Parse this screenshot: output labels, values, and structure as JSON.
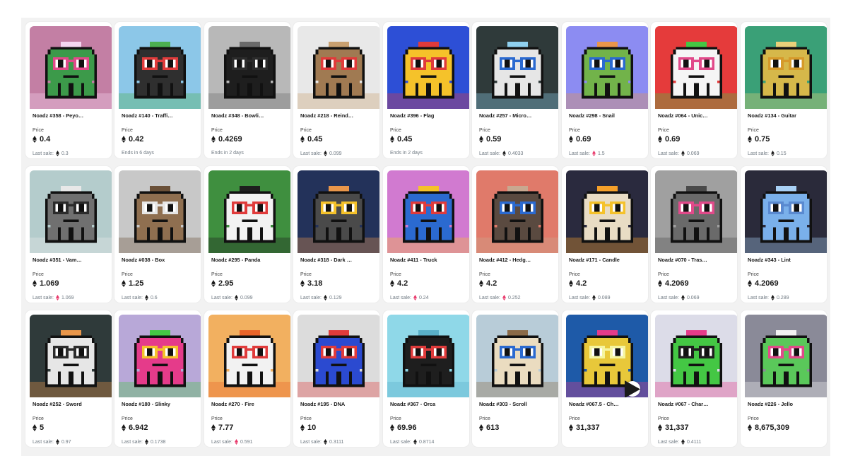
{
  "price_label": "Price",
  "cards": [
    {
      "name": "Noadz #358 - Peyo…",
      "price": "0.4",
      "footer_text": "Last sale:",
      "footer_value": "0.3",
      "footer_eth": "gray",
      "bg": "#c37fa4",
      "body": "#3c9a4a",
      "glasses": "#e14a8a",
      "accent": "#f4d6f0"
    },
    {
      "name": "Noadz #140 - Traffi…",
      "price": "0.42",
      "footer_text": "Ends in 6 days",
      "footer_value": "",
      "footer_eth": "none",
      "bg": "#8cc7e8",
      "body": "#2f2f2f",
      "glasses": "#e03b3b",
      "accent": "#4caf50"
    },
    {
      "name": "Noadz #348 - Bowli…",
      "price": "0.4269",
      "footer_text": "Ends in 2 days",
      "footer_value": "",
      "footer_eth": "none",
      "bg": "#b8b8b8",
      "body": "#1e1e1e",
      "glasses": "#2b2b2b",
      "accent": "#6a6a6a"
    },
    {
      "name": "Noadz #218 - Reind…",
      "price": "0.45",
      "footer_text": "Last sale:",
      "footer_value": "0.099",
      "footer_eth": "gray",
      "bg": "#e8e8e8",
      "body": "#a07a52",
      "glasses": "#e03b3b",
      "accent": "#c8a070"
    },
    {
      "name": "Noadz #396 - Flag",
      "price": "0.45",
      "footer_text": "Ends in 2 days",
      "footer_value": "",
      "footer_eth": "none",
      "bg": "#2d4fd6",
      "body": "#f5c22a",
      "glasses": "#e03b3b",
      "accent": "#e03b3b"
    },
    {
      "name": "Noadz #257 - Micro…",
      "price": "0.59",
      "footer_text": "Last sale:",
      "footer_value": "0.4033",
      "footer_eth": "gray",
      "bg": "#2f3a3a",
      "body": "#e6e6e6",
      "glasses": "#2b6ad0",
      "accent": "#8fd0ef"
    },
    {
      "name": "Noadz #298 - Snail",
      "price": "0.69",
      "footer_text": "Last sale:",
      "footer_value": "1.5",
      "footer_eth": "pink",
      "bg": "#8c8cf2",
      "body": "#72b34a",
      "glasses": "#2b6ad0",
      "accent": "#e9964a"
    },
    {
      "name": "Noadz #064 - Unic…",
      "price": "0.69",
      "footer_text": "Last sale:",
      "footer_value": "0.069",
      "footer_eth": "gray",
      "bg": "#e53b3b",
      "body": "#f5f5f5",
      "glasses": "#e14a8a",
      "accent": "#44c744"
    },
    {
      "name": "Noadz #134 - Guitar",
      "price": "0.75",
      "footer_text": "Last sale:",
      "footer_value": "0.15",
      "footer_eth": "gray",
      "bg": "#3aa077",
      "body": "#d6b84a",
      "glasses": "#d69a2a",
      "accent": "#e9d07a"
    },
    {
      "name": "Noadz #351 - Vam…",
      "price": "1.069",
      "footer_text": "Last sale:",
      "footer_value": "1.069",
      "footer_eth": "pink",
      "bg": "#b4cccc",
      "body": "#707070",
      "glasses": "#2b2b2b",
      "accent": "#e8e8e8"
    },
    {
      "name": "Noadz #038 - Box",
      "price": "1.25",
      "footer_text": "Last sale:",
      "footer_value": "0.6",
      "footer_eth": "gray",
      "bg": "#c8c8c8",
      "body": "#8f6f50",
      "glasses": "#e6e6e6",
      "accent": "#6a5038"
    },
    {
      "name": "Noadz #295 - Panda",
      "price": "2.95",
      "footer_text": "Last sale:",
      "footer_value": "0.099",
      "footer_eth": "gray",
      "bg": "#3f8f3f",
      "body": "#f2f2f2",
      "glasses": "#e03b3b",
      "accent": "#1e1e1e"
    },
    {
      "name": "Noadz #318 - Dark …",
      "price": "3.18",
      "footer_text": "Last sale:",
      "footer_value": "0.129",
      "footer_eth": "gray",
      "bg": "#23325a",
      "body": "#4a4a4a",
      "glasses": "#f5c22a",
      "accent": "#e9964a"
    },
    {
      "name": "Noadz #411 - Truck",
      "price": "4.2",
      "footer_text": "Last sale:",
      "footer_value": "0.24",
      "footer_eth": "pink",
      "bg": "#d17ad0",
      "body": "#2b6ad0",
      "glasses": "#e03b3b",
      "accent": "#f5c22a"
    },
    {
      "name": "Noadz #412 - Hedg…",
      "price": "4.2",
      "footer_text": "Last sale:",
      "footer_value": "0.252",
      "footer_eth": "pink",
      "bg": "#e07a6a",
      "body": "#5a4a40",
      "glasses": "#2b6ad0",
      "accent": "#c8a890"
    },
    {
      "name": "Noadz #171 - Candle",
      "price": "4.2",
      "footer_text": "Last sale:",
      "footer_value": "0.089",
      "footer_eth": "gray",
      "bg": "#2a2a3e",
      "body": "#e8dcc4",
      "glasses": "#f5c22a",
      "accent": "#f5a02a"
    },
    {
      "name": "Noadz #070 - Tras…",
      "price": "4.2069",
      "footer_text": "Last sale:",
      "footer_value": "0.069",
      "footer_eth": "gray",
      "bg": "#a0a0a0",
      "body": "#6a6a6a",
      "glasses": "#e14a8a",
      "accent": "#4a4a4a"
    },
    {
      "name": "Noadz #343 - Lint",
      "price": "4.2069",
      "footer_text": "Last sale:",
      "footer_value": "0.289",
      "footer_eth": "gray",
      "bg": "#2a2a3a",
      "body": "#7ab0ea",
      "glasses": "#5a8ad0",
      "accent": "#a8d0f5"
    },
    {
      "name": "Noadz #252 - Sword",
      "price": "5",
      "footer_text": "Last sale:",
      "footer_value": "0.97",
      "footer_eth": "gray",
      "bg": "#2f3a3a",
      "body": "#e6e6e6",
      "glasses": "#2b2b2b",
      "accent": "#e9964a"
    },
    {
      "name": "Noadz #180 - Slinky",
      "price": "6.942",
      "footer_text": "Last sale:",
      "footer_value": "0.1738",
      "footer_eth": "gray",
      "bg": "#b8a8d8",
      "body": "#e53b8a",
      "glasses": "#f5c22a",
      "accent": "#44c744"
    },
    {
      "name": "Noadz #270 - Fire",
      "price": "7.77",
      "footer_text": "Last sale:",
      "footer_value": "0.591",
      "footer_eth": "pink",
      "bg": "#f2b060",
      "body": "#f2f2f2",
      "glasses": "#e03b3b",
      "accent": "#e9642a"
    },
    {
      "name": "Noadz #195 - DNA",
      "price": "10",
      "footer_text": "Last sale:",
      "footer_value": "0.3111",
      "footer_eth": "gray",
      "bg": "#dcdcdc",
      "body": "#2b4ad0",
      "glasses": "#e03b3b",
      "accent": "#e03b3b"
    },
    {
      "name": "Noadz #367 - Orca",
      "price": "69.96",
      "footer_text": "Last sale:",
      "footer_value": "0.8714",
      "footer_eth": "gray",
      "bg": "#8fd8e8",
      "body": "#1e1e1e",
      "glasses": "#e03b3b",
      "accent": "#5ab0c8"
    },
    {
      "name": "Noadz #303 - Scroll",
      "price": "613",
      "footer_text": "",
      "footer_value": "",
      "footer_eth": "none",
      "bg": "#b8ccd8",
      "body": "#eadcc0",
      "glasses": "#2b6ad0",
      "accent": "#8a6a48"
    },
    {
      "name": "Noadz #067.5 - Ch…",
      "price": "31,337",
      "footer_text": "",
      "footer_value": "",
      "footer_eth": "none",
      "bg": "#1e5aa8",
      "body": "#e8c83a",
      "glasses": "#f5f5a0",
      "accent": "#e53b8a",
      "video": true
    },
    {
      "name": "Noadz #067 - Char…",
      "price": "31,337",
      "footer_text": "Last sale:",
      "footer_value": "0.4111",
      "footer_eth": "gray",
      "bg": "#dcdce8",
      "body": "#44c744",
      "glasses": "#1e1e1e",
      "accent": "#e53b8a"
    },
    {
      "name": "Noadz #226 - Jello",
      "price": "8,675,309",
      "footer_text": "",
      "footer_value": "",
      "footer_eth": "none",
      "bg": "#8a8a98",
      "body": "#5ac85a",
      "glasses": "#e14a8a",
      "accent": "#f2f2f2"
    }
  ]
}
